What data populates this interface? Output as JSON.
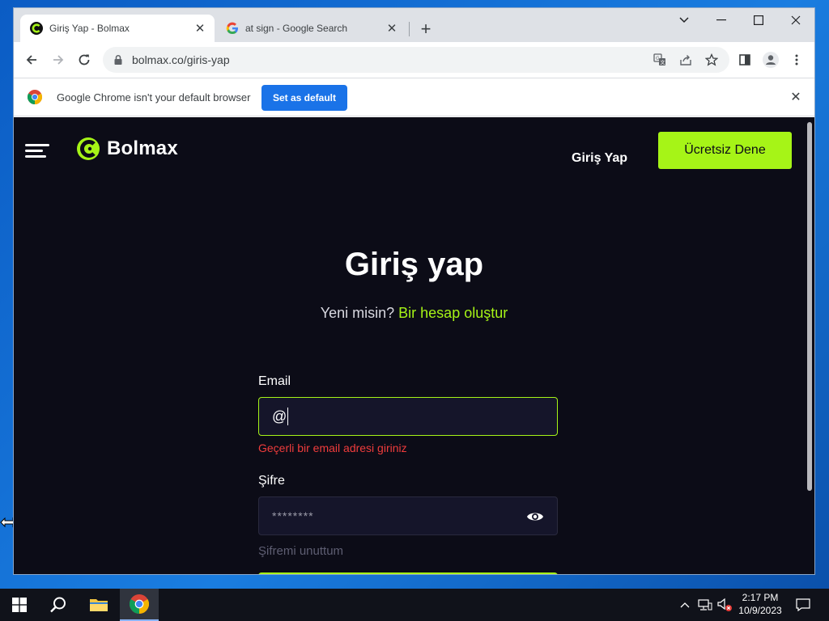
{
  "browser": {
    "tabs": [
      {
        "title": "Giriş Yap - Bolmax",
        "active": true
      },
      {
        "title": "at sign - Google Search",
        "active": false
      }
    ],
    "url": "bolmax.co/giris-yap",
    "infobar": {
      "message": "Google Chrome isn't your default browser",
      "button": "Set as default"
    }
  },
  "site": {
    "brand": "Bolmax",
    "nav": {
      "login": "Giriş Yap",
      "trial": "Ücretsiz Dene"
    },
    "heading": "Giriş yap",
    "subtitle_prefix": "Yeni misin?",
    "subtitle_link": "Bir hesap oluştur",
    "form": {
      "email_label": "Email",
      "email_value": "@",
      "email_error": "Geçerli bir email adresi giriniz",
      "password_label": "Şifre",
      "password_value": "********",
      "forgot": "Şifremi unuttum"
    }
  },
  "taskbar": {
    "time": "2:17 PM",
    "date": "10/9/2023"
  },
  "colors": {
    "accent": "#a6f417",
    "page_bg": "#0c0c17",
    "error": "#f03c3c",
    "chrome_blue": "#1a73e8"
  }
}
